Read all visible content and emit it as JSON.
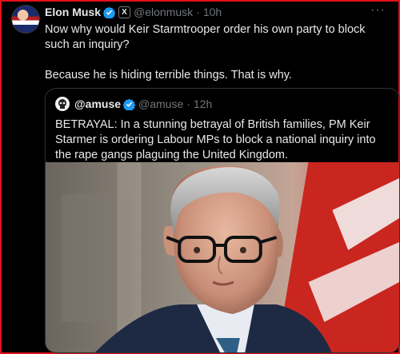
{
  "tweet": {
    "author_name": "Elon Musk",
    "author_handle": "@elonmusk",
    "separator": "·",
    "time": "10h",
    "x_badge": "X",
    "more": "···",
    "paragraphs": [
      "Now why would Keir Starmtrooper order his own party to block such an inquiry?",
      "Because he is hiding terrible things. That is why."
    ]
  },
  "quoted": {
    "author_name": "@amuse",
    "author_handle": "@amuse",
    "separator": "·",
    "time": "12h",
    "text": "BETRAYAL: In a stunning betrayal of British families, PM Keir Starmer is ordering Labour MPs to block a national inquiry into the rape gangs plaguing the United Kingdom."
  },
  "colors": {
    "verified": "#1d9bf0",
    "border_highlight": "#e0101a"
  }
}
